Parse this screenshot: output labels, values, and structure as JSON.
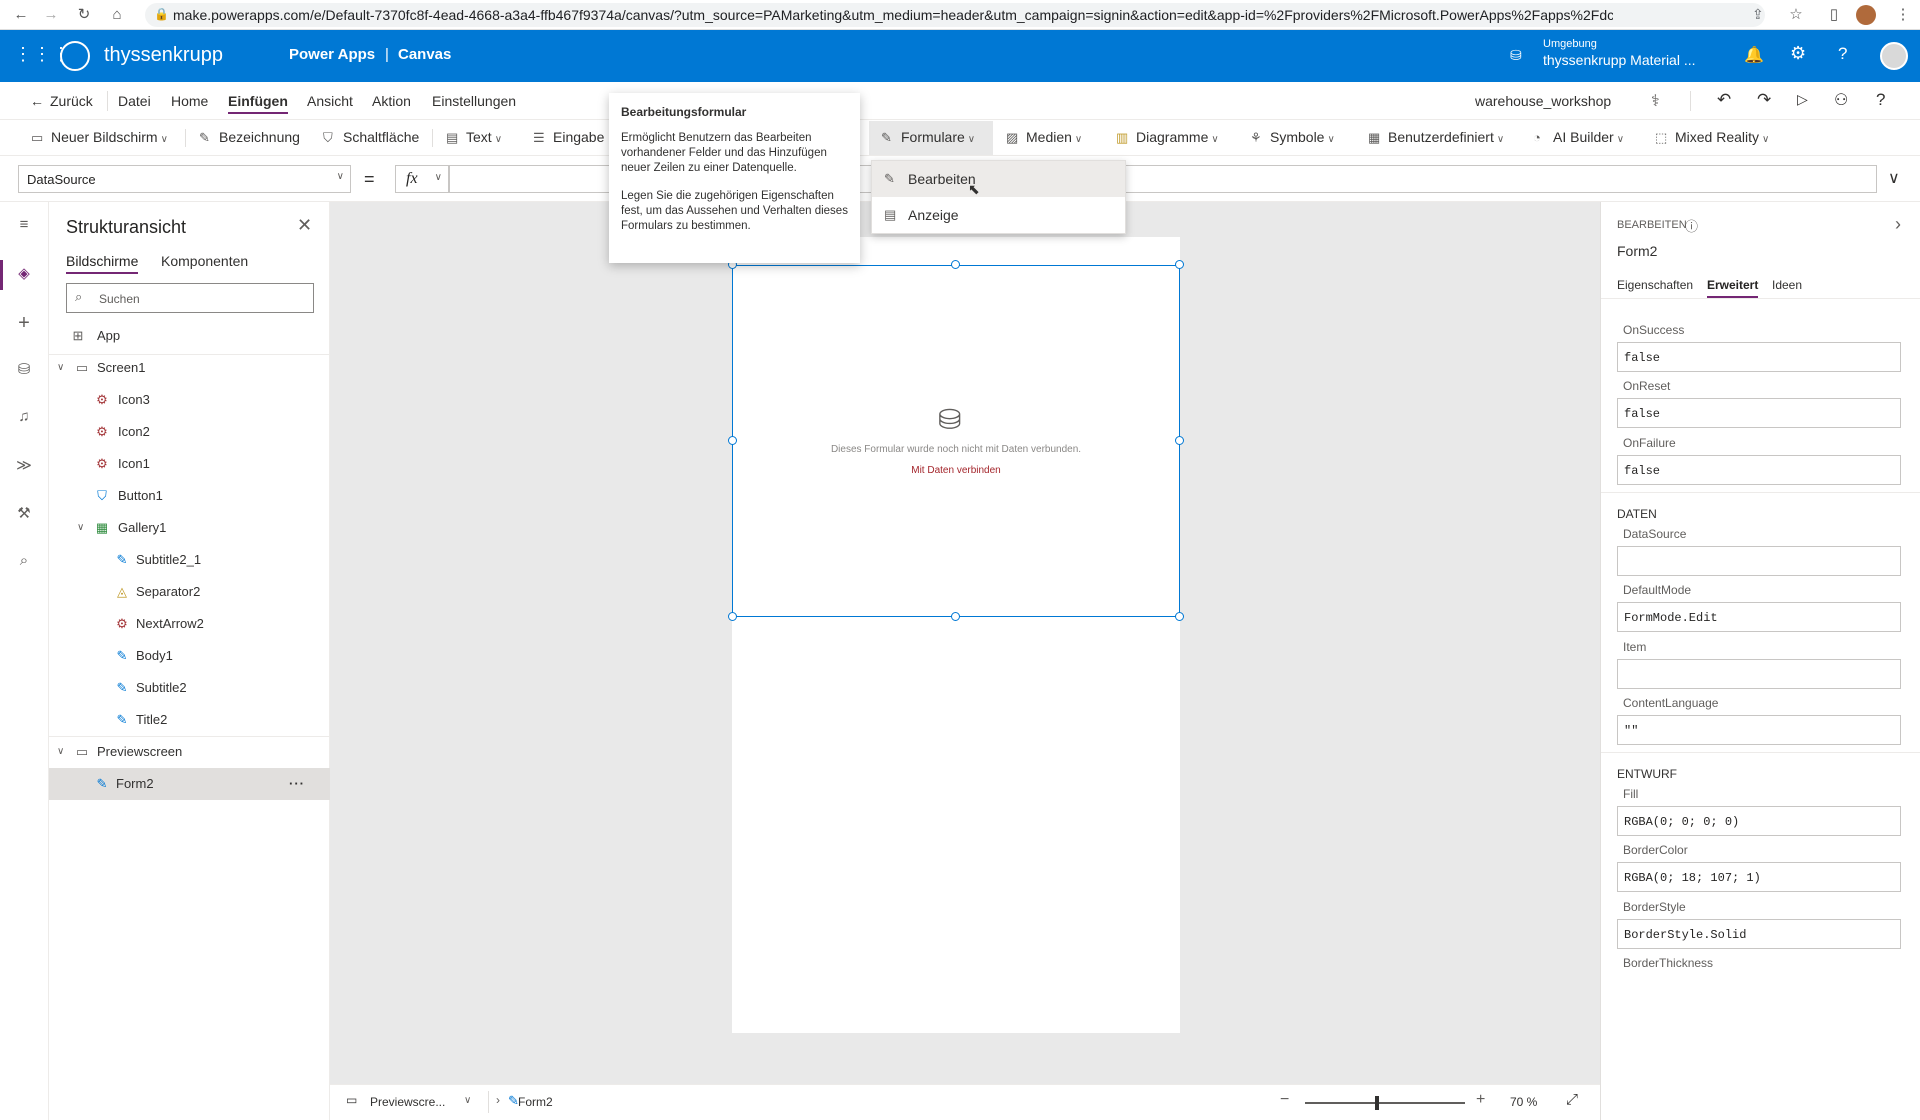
{
  "browser": {
    "url": "make.powerapps.com/e/Default-7370fc8f-4ead-4668-a3a4-ffb467f9374a/canvas/?utm_source=PAMarketing&utm_medium=header&utm_campaign=signin&action=edit&app-id=%2Fproviders%2FMicrosoft.PowerApps%2Fapps%2Fdc1b1db8-be60-470..."
  },
  "header": {
    "brand": "thyssenkrupp",
    "product": "Power Apps",
    "separator": "|",
    "mode": "Canvas",
    "env_label": "Umgebung",
    "env_name": "thyssenkrupp Material ..."
  },
  "menu": {
    "back": "Zurück",
    "items": [
      "Datei",
      "Home",
      "Einfügen",
      "Ansicht",
      "Aktion",
      "Einstellungen"
    ],
    "active": "Einfügen",
    "app_name": "warehouse_workshop"
  },
  "toolbar": {
    "new_screen": "Neuer Bildschirm",
    "label": "Bezeichnung",
    "button": "Schaltfläche",
    "text": "Text",
    "input": "Eingabe",
    "forms": "Formulare",
    "media": "Medien",
    "charts": "Diagramme",
    "icons": "Symbole",
    "custom": "Benutzerdefiniert",
    "ai": "AI Builder",
    "mr": "Mixed Reality"
  },
  "formula": {
    "property": "DataSource",
    "equals": "=",
    "fx": "fx",
    "value": ""
  },
  "tree": {
    "title": "Strukturansicht",
    "tab_screens": "Bildschirme",
    "tab_components": "Komponenten",
    "search_placeholder": "Suchen",
    "nodes": [
      "App",
      "Screen1",
      "Icon3",
      "Icon2",
      "Icon1",
      "Button1",
      "Gallery1",
      "Subtitle2_1",
      "Separator2",
      "NextArrow2",
      "Body1",
      "Subtitle2",
      "Title2",
      "Previewscreen",
      "Form2"
    ],
    "more": "···"
  },
  "tooltip": {
    "title": "Bearbeitungsformular",
    "p1": "Ermöglicht Benutzern das Bearbeiten vorhandener Felder und das Hinzufügen neuer Zeilen zu einer Datenquelle.",
    "p2": "Legen Sie die zugehörigen Eigenschaften fest, um das Aussehen und Verhalten dieses Formulars zu bestimmen."
  },
  "dropdown": {
    "items": [
      "Bearbeiten",
      "Anzeige"
    ]
  },
  "form": {
    "message": "Dieses Formular wurde noch nicht mit Daten verbunden.",
    "link": "Mit Daten verbinden"
  },
  "status": {
    "screen": "Previewscre...",
    "control": "Form2",
    "zoom": "70 %",
    "zoom_fraction": 0.45
  },
  "props": {
    "kind": "BEARBEITEN",
    "name": "Form2",
    "tabs": [
      "Eigenschaften",
      "Erweitert",
      "Ideen"
    ],
    "active_tab": "Erweitert",
    "on_success_label": "OnSuccess",
    "on_success": "false",
    "on_reset_label": "OnReset",
    "on_reset": "false",
    "on_failure_label": "OnFailure",
    "on_failure": "false",
    "sec_data": "DATEN",
    "datasource_label": "DataSource",
    "datasource": "",
    "defaultmode_label": "DefaultMode",
    "defaultmode": "FormMode.Edit",
    "item_label": "Item",
    "item": "",
    "contentlang_label": "ContentLanguage",
    "contentlang": "\"\"",
    "sec_design": "ENTWURF",
    "fill_label": "Fill",
    "fill": "RGBA(0; 0; 0; 0)",
    "bordercolor_label": "BorderColor",
    "bordercolor": "RGBA(0; 18; 107; 1)",
    "borderstyle_label": "BorderStyle",
    "borderstyle": "BorderStyle.Solid",
    "borderthickness_label": "BorderThickness"
  },
  "colors": {
    "header": "#0078d4",
    "accent_purple": "#742774",
    "link_purple": "#a4373a",
    "selection_blue": "#0078d4"
  }
}
